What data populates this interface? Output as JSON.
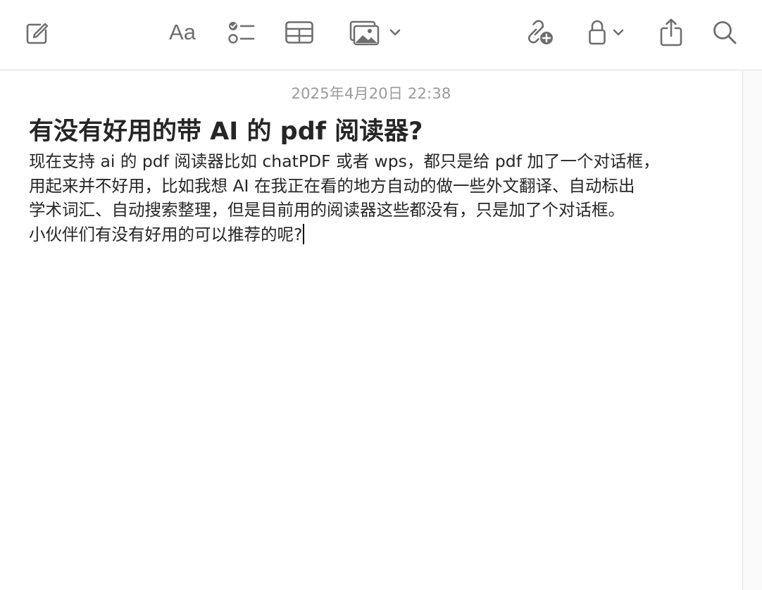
{
  "toolbar": {
    "compose": "compose-icon",
    "format": "Aa",
    "checklist": "checklist-icon",
    "table": "table-icon",
    "media": "photo-icon",
    "media_menu": "chevron-down-icon",
    "collaborate": "link-add-icon",
    "lock": "lock-icon",
    "lock_menu": "chevron-down-icon",
    "share": "share-icon",
    "search": "search-icon"
  },
  "note": {
    "date": "2025年4月20日 22:38",
    "title": "有没有好用的带 AI 的 pdf 阅读器?",
    "body_lines": [
      "现在支持 ai 的 pdf 阅读器比如 chatPDF 或者 wps，都只是给 pdf 加了一个对话框，",
      "用起来并不好用，比如我想 AI 在我正在看的地方自动的做一些外文翻译、自动标出",
      "学术词汇、自动搜索整理，但是目前用的阅读器这些都没有，只是加了个对话框。",
      "小伙伴们有没有好用的可以推荐的呢?"
    ]
  },
  "colors": {
    "icon": "#6e6e6e",
    "text": "#262626",
    "date": "#9a9a9a",
    "divider": "#dcdcdc"
  }
}
